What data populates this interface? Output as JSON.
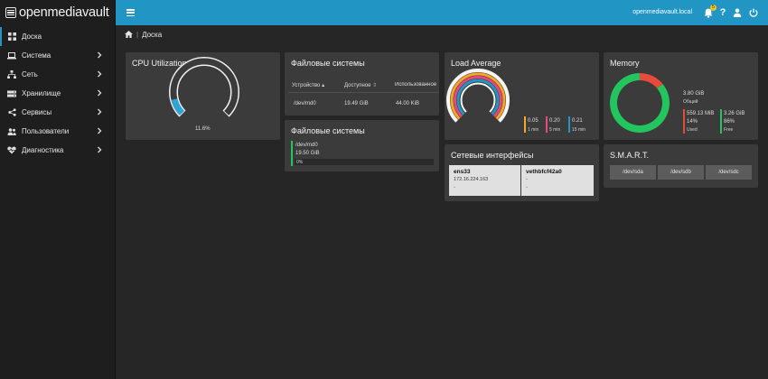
{
  "app": {
    "brand": "openmediavault",
    "host": "openmediavault.local",
    "notification_count": "5"
  },
  "sidebar": {
    "items": [
      {
        "label": "Доска",
        "icon": "dashboard-icon",
        "active": true,
        "chevron": false
      },
      {
        "label": "Система",
        "icon": "laptop-icon",
        "active": false,
        "chevron": true
      },
      {
        "label": "Сеть",
        "icon": "network-icon",
        "active": false,
        "chevron": true
      },
      {
        "label": "Хранилище",
        "icon": "storage-icon",
        "active": false,
        "chevron": true
      },
      {
        "label": "Сервисы",
        "icon": "share-icon",
        "active": false,
        "chevron": true
      },
      {
        "label": "Пользователи",
        "icon": "users-icon",
        "active": false,
        "chevron": true
      },
      {
        "label": "Диагностика",
        "icon": "heartbeat-icon",
        "active": false,
        "chevron": true
      }
    ]
  },
  "breadcrumb": {
    "home_icon": "home-icon",
    "page": "Доска"
  },
  "cpu": {
    "title": "CPU Utilization",
    "percent": 11.6,
    "label": "11.6%"
  },
  "fs_table": {
    "title": "Файловые системы",
    "headers": {
      "device": "Устройство",
      "available": "Доступное",
      "used": "Использованное"
    },
    "row": {
      "device": "/dev/md0",
      "available": "19.49 GiB",
      "used": "44.00 KiB"
    }
  },
  "fs_bar": {
    "title": "Файловые системы",
    "device": "/dev/md0",
    "size": "19.50 GiB",
    "percent_label": "0%",
    "percent": 0
  },
  "load": {
    "title": "Load Average",
    "values": [
      {
        "value": "0.05",
        "label": "1 min",
        "color": "#f5a623"
      },
      {
        "value": "0.20",
        "label": "5 min",
        "color": "#e64980"
      },
      {
        "value": "0.21",
        "label": "15 min",
        "color": "#2196c4"
      }
    ]
  },
  "memory": {
    "title": "Memory",
    "total": "3.80 GiB",
    "total_label": "Общий",
    "used": "559.13 MiB",
    "used_pct": "14%",
    "used_label": "Used",
    "free": "3.26 GiB",
    "free_pct": "86%",
    "free_label": "Free",
    "used_fraction": 0.14,
    "used_color": "#e84a3c",
    "free_color": "#22c55e"
  },
  "network": {
    "title": "Сетевые интерфейсы",
    "interfaces": [
      {
        "name": "ens33",
        "line1": "172.16.224.163",
        "line2": "-"
      },
      {
        "name": "vethbfcf42a0",
        "line1": "-",
        "line2": "-"
      }
    ]
  },
  "smart": {
    "title": "S.M.A.R.T.",
    "disks": [
      "/dev/sda",
      "/dev/sdb",
      "/dev/sdc"
    ]
  }
}
